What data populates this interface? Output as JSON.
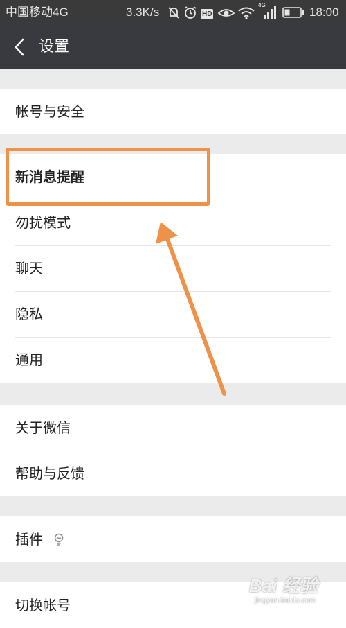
{
  "status_bar": {
    "carrier": "中国移动4G",
    "speed": "3.3K/s",
    "icons": [
      "mute-icon",
      "alarm-icon",
      "hd-icon",
      "eye-icon",
      "wifi-icon",
      "signal-4g-icon",
      "battery-icon"
    ],
    "network_badge": "4G",
    "hd_badge": "HD",
    "time": "18:00"
  },
  "header": {
    "back_icon": "chevron-left-icon",
    "title": "设置"
  },
  "groups": [
    {
      "items": [
        "帐号与安全"
      ]
    },
    {
      "items": [
        "新消息提醒",
        "勿扰模式",
        "聊天",
        "隐私",
        "通用"
      ]
    },
    {
      "items": [
        "关于微信",
        "帮助与反馈"
      ]
    },
    {
      "items": [
        "插件"
      ],
      "item_icon": "lightbulb-icon"
    },
    {
      "items": [
        "切换帐号"
      ]
    }
  ],
  "annotation": {
    "highlighted_item": "新消息提醒",
    "color": "#f0914a"
  },
  "watermark": {
    "logo": "Bai 经验",
    "site": "jingyan.baidu.com"
  },
  "colors": {
    "status_bar_bg": "#3a3a3a",
    "title_bar_bg": "#393a3f",
    "page_bg": "#ebebeb",
    "item_bg": "#ffffff",
    "annotation": "#f0914a"
  }
}
